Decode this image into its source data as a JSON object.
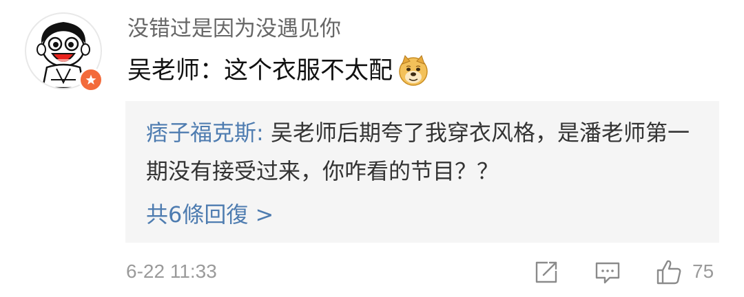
{
  "comment": {
    "username": "没错过是因为没遇见你",
    "text": "吴老师：这个衣服不太配",
    "emoji_icon": "doge-emoji-icon",
    "timestamp": "6-22 11:33",
    "like_count": "75"
  },
  "reply": {
    "author": "痞子福克斯:",
    "text": " 吴老师后期夸了我穿衣风格，是潘老师第一期没有接受过来，你咋看的节目？？",
    "more_replies": "共6條回復 >"
  },
  "colors": {
    "link_blue": "#4e7cb0",
    "meta_gray": "#9a9a9a",
    "badge_orange": "#f36b3b",
    "reply_bg": "#f5f5f5"
  },
  "icons": {
    "share": "share-icon",
    "comment": "comment-icon",
    "like": "thumbs-up-icon"
  }
}
